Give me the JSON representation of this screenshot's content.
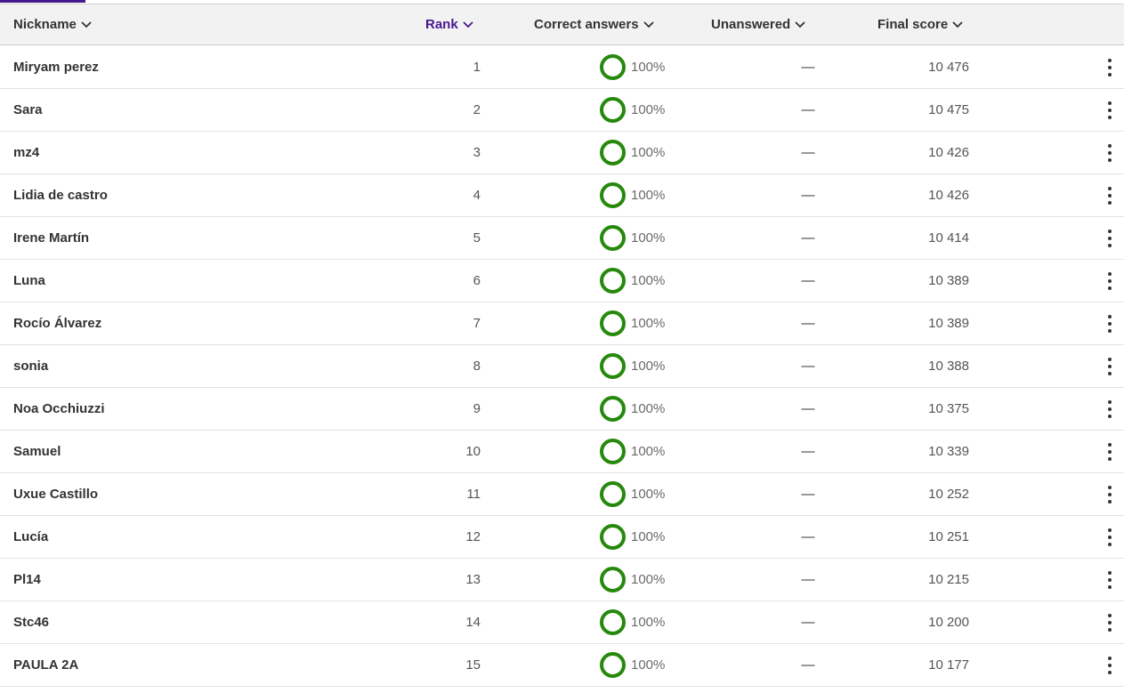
{
  "colors": {
    "accent": "#46178f",
    "correct_ring": "#26890c",
    "header_bg": "#f2f2f2"
  },
  "header": {
    "columns": [
      {
        "key": "nickname",
        "label": "Nickname",
        "icon": "chevron-down-icon"
      },
      {
        "key": "rank",
        "label": "Rank",
        "icon": "chevron-down-icon",
        "active": true
      },
      {
        "key": "correct",
        "label": "Correct answers",
        "icon": "chevron-down-icon"
      },
      {
        "key": "unanswered",
        "label": "Unanswered",
        "icon": "chevron-down-icon"
      },
      {
        "key": "final_score",
        "label": "Final score",
        "icon": "chevron-down-icon"
      }
    ]
  },
  "rows": [
    {
      "nickname": "Miryam perez",
      "rank": "1",
      "correct": "100%",
      "unanswered": "—",
      "score": "10 476"
    },
    {
      "nickname": "Sara",
      "rank": "2",
      "correct": "100%",
      "unanswered": "—",
      "score": "10 475"
    },
    {
      "nickname": "mz4",
      "rank": "3",
      "correct": "100%",
      "unanswered": "—",
      "score": "10 426"
    },
    {
      "nickname": "Lidia de castro",
      "rank": "4",
      "correct": "100%",
      "unanswered": "—",
      "score": "10 426"
    },
    {
      "nickname": "Irene Martín",
      "rank": "5",
      "correct": "100%",
      "unanswered": "—",
      "score": "10 414"
    },
    {
      "nickname": "Luna",
      "rank": "6",
      "correct": "100%",
      "unanswered": "—",
      "score": "10 389"
    },
    {
      "nickname": "Rocío Álvarez",
      "rank": "7",
      "correct": "100%",
      "unanswered": "—",
      "score": "10 389"
    },
    {
      "nickname": "sonia",
      "rank": "8",
      "correct": "100%",
      "unanswered": "—",
      "score": "10 388"
    },
    {
      "nickname": "Noa Occhiuzzi",
      "rank": "9",
      "correct": "100%",
      "unanswered": "—",
      "score": "10 375"
    },
    {
      "nickname": "Samuel",
      "rank": "10",
      "correct": "100%",
      "unanswered": "—",
      "score": "10 339"
    },
    {
      "nickname": "Uxue Castillo",
      "rank": "11",
      "correct": "100%",
      "unanswered": "—",
      "score": "10 252"
    },
    {
      "nickname": "Lucía",
      "rank": "12",
      "correct": "100%",
      "unanswered": "—",
      "score": "10 251"
    },
    {
      "nickname": "Pl14",
      "rank": "13",
      "correct": "100%",
      "unanswered": "—",
      "score": "10 215"
    },
    {
      "nickname": "Stc46",
      "rank": "14",
      "correct": "100%",
      "unanswered": "—",
      "score": "10 200"
    },
    {
      "nickname": "PAULA 2A",
      "rank": "15",
      "correct": "100%",
      "unanswered": "—",
      "score": "10 177"
    }
  ]
}
